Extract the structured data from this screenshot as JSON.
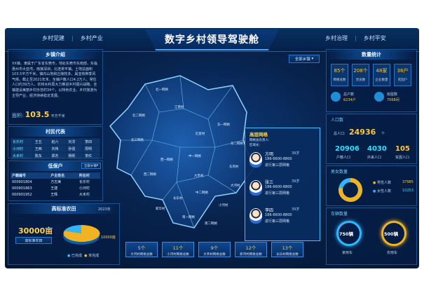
{
  "header": {
    "title": "数字乡村领导驾驶舱",
    "nav_left": [
      "乡村党建",
      "乡村产业"
    ],
    "nav_right": [
      "乡村治理",
      "乡村平安"
    ]
  },
  "town_select": "全部乡镇",
  "intro": {
    "title": "乡镇介绍",
    "text": "XX镇，隶属于广东省东莞市，地处东莞市东南部，东临惠州市大亚湾，南接深圳，北连常平镇。土地总面积103.5平方千米，镇内山地和丘陵较多，属亚热带季风气候。截止至2021年末，全镇户籍人口4.2万人，常住人口约39万人。农林水利局大力推进乡村振兴战略，全镇建设美丽乡村示范村34个，以特色农业、乡村旅游为主导产业，经济持续稳定发展。",
    "area_label": "面积:",
    "area_value": "103.5",
    "area_unit": "平方千米"
  },
  "village_rep": {
    "title": "村民代表",
    "rows": [
      [
        "长乐村",
        "王五",
        "赵六",
        "刘洋",
        "李四"
      ],
      [
        "小河村",
        "王西",
        "刘伟",
        "孙强",
        "周明"
      ],
      [
        "大禾村",
        "陈东",
        "郑杰",
        "杨帆",
        "李红"
      ]
    ]
  },
  "insurance": {
    "title": "低保户",
    "select": "全部乡镇",
    "headers": [
      "户籍编号",
      "户主姓名",
      "所在村"
    ],
    "rows": [
      [
        "000901804",
        "方志美",
        "长乐村"
      ],
      [
        "000901863",
        "王建",
        "小河村"
      ],
      [
        "000901952",
        "王辉",
        "大禾村"
      ]
    ]
  },
  "farmland": {
    "title": "高标准农田",
    "year": "2023年",
    "value": "30000亩",
    "tag": "高标准农田",
    "target": "10000亩",
    "legend": [
      "已完成",
      "未完成"
    ]
  },
  "popup": {
    "title": "高层网格",
    "leader_label": "网格总负责人:",
    "leader": "",
    "manager_label": "区域长:",
    "manager": "",
    "persons": [
      {
        "name": "方明",
        "age": "39岁",
        "tel": "186-6600-8800",
        "note": "进行第三层网格"
      },
      {
        "name": "张三",
        "age": "39岁",
        "tel": "186-6600-8800",
        "note": "进行第三层网格"
      },
      {
        "name": "李四",
        "age": "39岁",
        "tel": "186-6600-8800",
        "note": "进行第三层网格"
      }
    ]
  },
  "map_labels": [
    "北一网格",
    "北二网格",
    "北三网格",
    "东一网格",
    "东二网格",
    "西一网格",
    "西二网格",
    "中一网格",
    "中二网格",
    "南一网格",
    "南二网格",
    "大河村",
    "长乐村",
    "小河村",
    "大禾村",
    "江南村",
    "新华村",
    "东风村",
    "红星村"
  ],
  "bottom_buttons": [
    {
      "value": "5个",
      "label": "大河村网格总数"
    },
    {
      "value": "11个",
      "label": "小河村网格总数"
    },
    {
      "value": "9个",
      "label": "大禾村网格总数"
    },
    {
      "value": "12个",
      "label": "新河村网格总数"
    },
    {
      "value": "13个",
      "label": "长乐村网格总数"
    }
  ],
  "stats": {
    "title": "数量统计",
    "items": [
      {
        "value": "85个",
        "label": "网格总数"
      },
      {
        "value": "208个",
        "label": "党员数"
      },
      {
        "value": "48家",
        "label": "企业数量"
      },
      {
        "value": "36户",
        "label": "贫困户"
      }
    ],
    "households": [
      {
        "label": "总户数",
        "value": "6234户"
      },
      {
        "label": "房屋数",
        "value": "7068间"
      }
    ]
  },
  "population": {
    "title": "人口数",
    "total_label": "总人口:",
    "total": "24936",
    "total_unit": "个",
    "items": [
      {
        "value": "20906",
        "label": "户籍人口"
      },
      {
        "value": "4030",
        "label": "外来人口"
      },
      {
        "value": "105",
        "label": "贫困人口"
      }
    ]
  },
  "gender": {
    "title": "男女数量",
    "male_label": "男性人数",
    "male": "37985",
    "female_label": "女性人数",
    "female": "10253",
    "male_share": 0.78
  },
  "cars": {
    "title": "车辆数量",
    "items": [
      {
        "value": "750辆",
        "label": "家用车"
      },
      {
        "value": "500辆",
        "label": "农用车"
      }
    ]
  }
}
